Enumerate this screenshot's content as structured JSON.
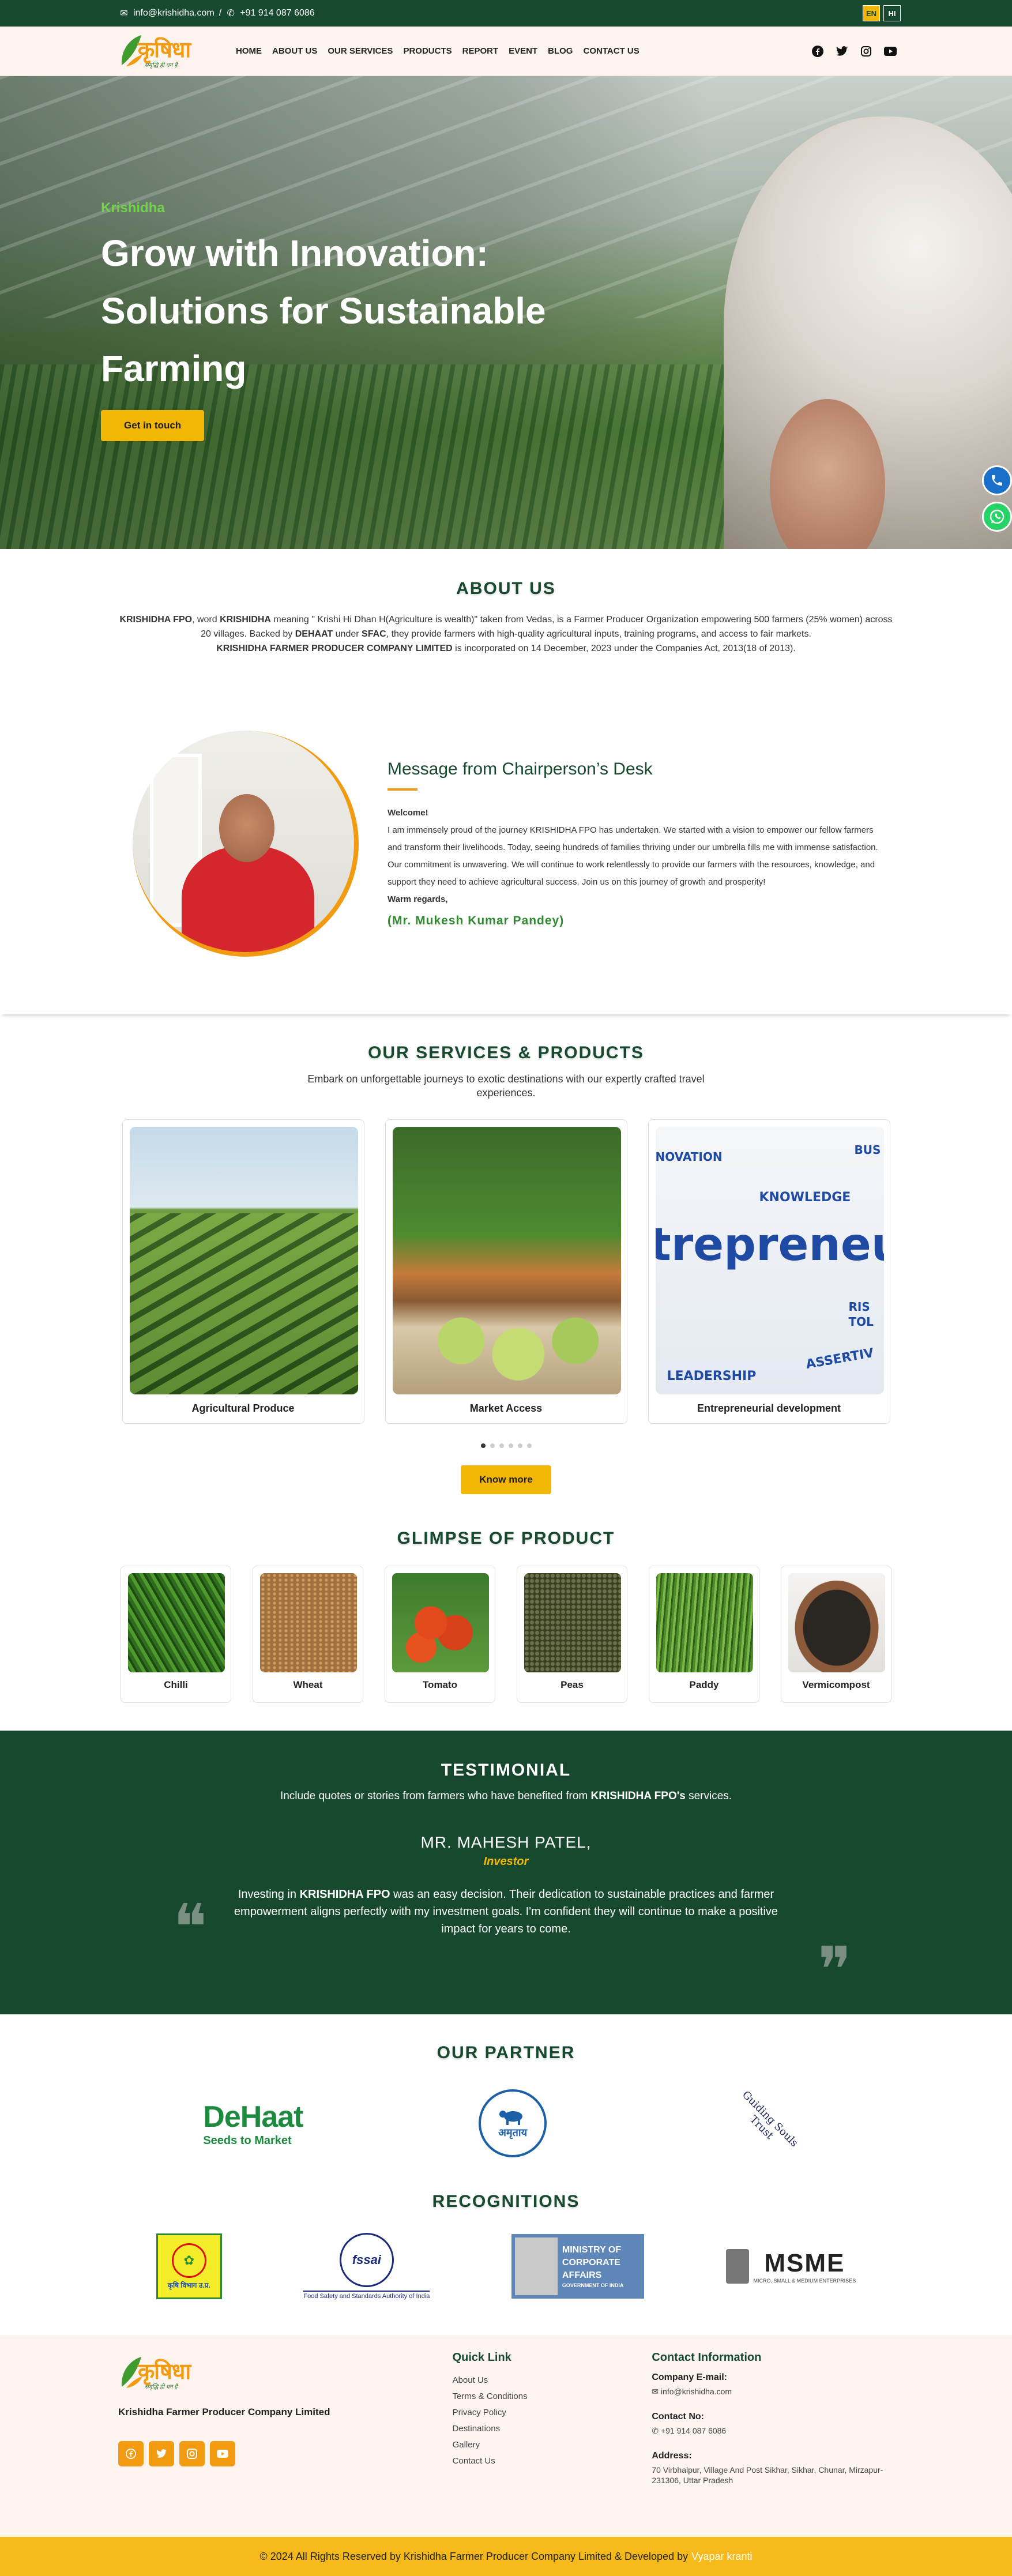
{
  "topbar": {
    "email": "info@krishidha.com",
    "separator": "/",
    "phone": "+91 914 087 6086",
    "lang_en": "EN",
    "lang_hi": "HI",
    "colors": {
      "bg": "#17492f",
      "active_lang": "#f2b705"
    }
  },
  "logo": {
    "word": "कृषिधा",
    "tagline": "समृद्धि ही धन है"
  },
  "nav": {
    "items": [
      "HOME",
      "ABOUT US",
      "OUR SERVICES",
      "PRODUCTS",
      "REPORT",
      "EVENT",
      "BLOG",
      "CONTACT US"
    ],
    "social_icons": [
      "facebook-icon",
      "twitter-icon",
      "instagram-icon",
      "youtube-icon"
    ]
  },
  "hero": {
    "brand": "Krishidha",
    "title": "Grow with Innovation: Solutions for Sustainable Farming",
    "cta": "Get in touch"
  },
  "about": {
    "title": "ABOUT US",
    "p1_a": "KRISHIDHA FPO",
    "p1_b": ", word ",
    "p1_c": "KRISHIDHA",
    "p1_d": " meaning \" Krishi Hi Dhan H(Agriculture is wealth)\" taken from Vedas, is a Farmer Producer Organization empowering 500 farmers (25% women) across 20 villages. Backed by ",
    "p1_e": "DEHAAT",
    "p1_f": " under ",
    "p1_g": "SFAC",
    "p1_h": ", they provide farmers with high-quality agricultural inputs, training programs, and access to fair markets.",
    "p2_a": "KRISHIDHA FARMER PRODUCER COMPANY LIMITED",
    "p2_b": " is incorporated on 14 December, 2023 under the Companies Act, 2013(18 of 2013)."
  },
  "chairperson": {
    "title": "Message from Chairperson’s Desk",
    "welcome": "Welcome!",
    "body": "I am immensely proud of the journey KRISHIDHA FPO has undertaken. We started with a vision to empower our fellow farmers and transform their livelihoods. Today, seeing hundreds of families thriving under our umbrella fills me with immense satisfaction. Our commitment is unwavering. We will continue to work relentlessly to provide our farmers with the resources, knowledge, and support they need to achieve agricultural success. Join us on this journey of growth and prosperity!",
    "regards": "Warm regards,",
    "signature": "(Mr. Mukesh Kumar Pandey)"
  },
  "services": {
    "title": "OUR SERVICES & PRODUCTS",
    "subtitle": "Embark on unforgettable journeys to exotic destinations with our expertly crafted travel experiences.",
    "cards": [
      "Agricultural Produce",
      "Market Access",
      "Entrepreneurial development"
    ],
    "carousel_active": 1,
    "carousel_count": 6,
    "button": "Know more",
    "entre_words": [
      "NOVATION",
      "BUS",
      "KNOWLEDGE",
      "trepreneu",
      "RIS",
      "TOL",
      "LEADERSHIP",
      "ASSERTIV"
    ]
  },
  "glimpse": {
    "title": "GLIMPSE OF PRODUCT",
    "items": [
      "Chilli",
      "Wheat",
      "Tomato",
      "Peas",
      "Paddy",
      "Vermicompost"
    ]
  },
  "testimonial": {
    "title": "TESTIMONIAL",
    "sub_a": "Include quotes or stories from farmers who have benefited from ",
    "sub_b": "KRISHIDHA FPO's",
    "sub_c": " services.",
    "name": "MR. MAHESH PATEL,",
    "role": "Investor",
    "quote_a": "Investing in ",
    "quote_b": "KRISHIDHA FPO",
    "quote_c": " was an easy decision. Their dedication to sustainable practices and farmer empowerment aligns perfectly with my investment goals. I'm confident they will continue to make a positive impact for years to come.",
    "open_quote": "❝",
    "close_quote": "❞"
  },
  "partners": {
    "title": "OUR PARTNER",
    "dehaat_1": "DeHaat",
    "dehaat_2": "Seeds to Market",
    "amul": "अमृताय",
    "gst": "Guiding Souls Trust"
  },
  "recognitions": {
    "title": "RECOGNITIONS",
    "krishi": "कृषि विभाग उ.प्र.",
    "fssai": "fssai",
    "fssai_sub": "Food Safety and Standards Authority of India",
    "mca": [
      "MINISTRY OF",
      "CORPORATE",
      "AFFAIRS"
    ],
    "mca_sub": "GOVERNMENT OF INDIA",
    "msme": "MSME",
    "msme_sub": "MICRO, SMALL & MEDIUM ENTERPRISES"
  },
  "footer": {
    "company": "Krishidha Farmer Producer Company Limited",
    "social_icons": [
      "facebook-icon",
      "twitter-icon",
      "instagram-icon",
      "youtube-icon"
    ],
    "quick_title": "Quick Link",
    "links": [
      "About Us",
      "Terms & Conditions",
      "Privacy Policy",
      "Destinations",
      "Gallery",
      "Contact Us"
    ],
    "contact_title": "Contact Information",
    "email_label": "Company E-mail:",
    "email": "info@krishidha.com",
    "phone_label": "Contact No:",
    "phone": "+91 914 087 6086",
    "address_label": "Address:",
    "address": "70 Virbhalpur, Village And Post Sikhar, Sikhar, Chunar, Mirzapur- 231306, Uttar Pradesh"
  },
  "copyright": {
    "text": "© 2024 All Rights Reserved by Krishidha Farmer Producer Company Limited & Developed by",
    "developer": "Vyapar kranti"
  }
}
